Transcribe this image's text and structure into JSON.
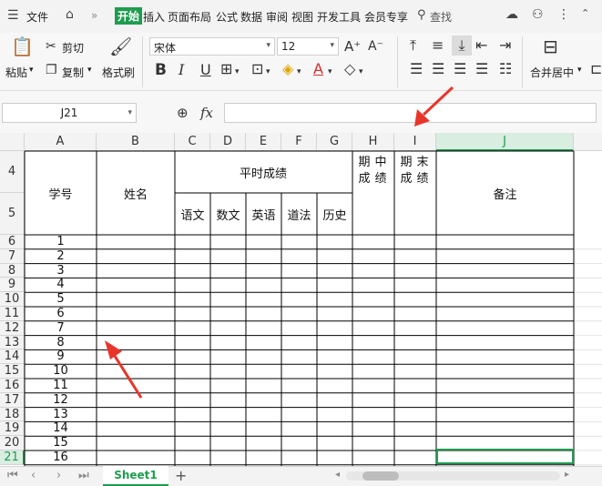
{
  "menubar": {
    "file_label": "文件",
    "more": "»",
    "tabs": [
      "开始",
      "插入",
      "页面布局",
      "公式",
      "数据",
      "审阅",
      "视图",
      "开发工具",
      "会员专享"
    ],
    "search_label": "查找"
  },
  "ribbon": {
    "paste": "粘贴",
    "cut": "剪切",
    "copy": "复制",
    "format_painter": "格式刷",
    "font_name": "宋体",
    "font_size": "12",
    "merge_center": "合并居中"
  },
  "formula_bar": {
    "name_box": "J21",
    "fx": "fx",
    "value": ""
  },
  "sheet": {
    "columns": [
      "A",
      "B",
      "C",
      "D",
      "E",
      "F",
      "G",
      "H",
      "I",
      "J"
    ],
    "selected_column": "J",
    "rows": [
      "4",
      "5",
      "6",
      "7",
      "8",
      "9",
      "10",
      "11",
      "12",
      "13",
      "14",
      "15",
      "16",
      "17",
      "18",
      "19",
      "20",
      "21"
    ],
    "selected_row": "21",
    "header": {
      "student_id": "学号",
      "name": "姓名",
      "regular_scores": "平时成绩",
      "subjects": [
        "语文",
        "数文",
        "英语",
        "道法",
        "历史"
      ],
      "midterm": "期中成绩",
      "final": "期末成绩",
      "remarks": "备注"
    },
    "numbers": [
      "1",
      "2",
      "3",
      "4",
      "5",
      "6",
      "7",
      "8",
      "9",
      "10",
      "11",
      "12",
      "13",
      "14",
      "15",
      "16"
    ]
  },
  "tabbar": {
    "sheet_name": "Sheet1",
    "add": "+"
  },
  "colors": {
    "accent": "#1e9c4e",
    "arrow": "#e8352b"
  }
}
